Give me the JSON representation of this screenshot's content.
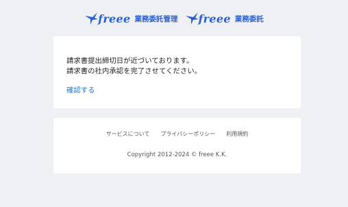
{
  "header": {
    "logos": [
      {
        "word": "freee",
        "product": "業務委託管理"
      },
      {
        "word": "freee",
        "product": "業務委託"
      }
    ]
  },
  "main": {
    "message_line1": "請求書提出締切日が近づいております。",
    "message_line2": "請求書の社内承認を完了させてください。",
    "confirm_label": "確認する"
  },
  "footer": {
    "links": [
      "サービスについて",
      "プライバシーポリシー",
      "利用規約"
    ],
    "copyright": "Copyright 2012-2024 © freee K.K."
  },
  "colors": {
    "brand": "#2b5fcf",
    "link": "#2e74c0",
    "background": "#eef0f3"
  }
}
